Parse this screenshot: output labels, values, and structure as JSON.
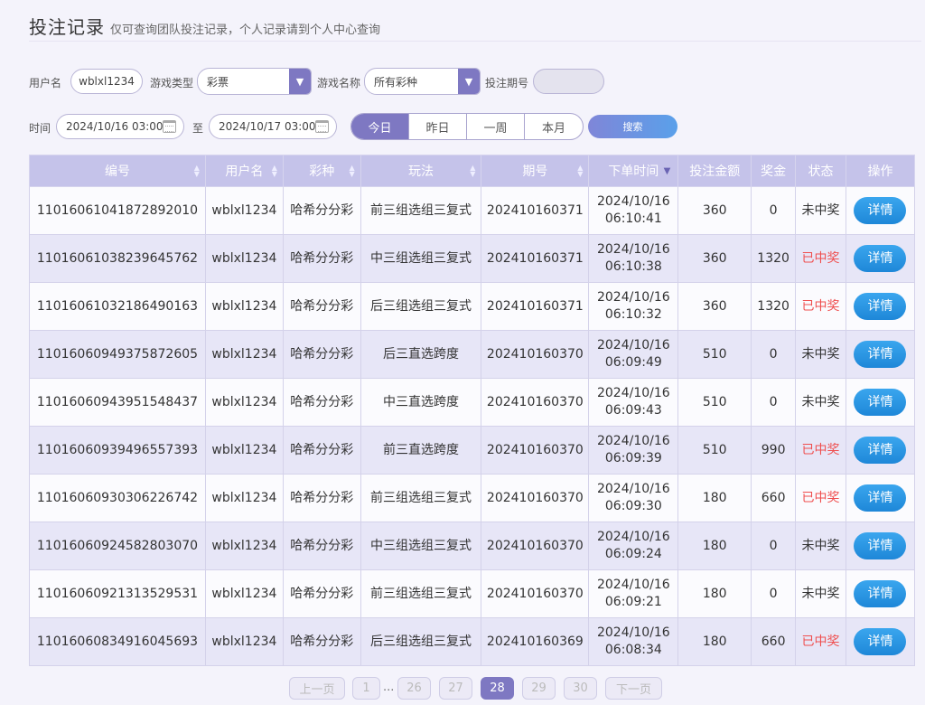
{
  "header": {
    "title": "投注记录",
    "subtitle": "仅可查询团队投注记录，个人记录请到个人中心查询"
  },
  "filters": {
    "username_label": "用户名",
    "username_value": "wblxl1234",
    "game_type_label": "游戏类型",
    "game_type_value": "彩票",
    "game_name_label": "游戏名称",
    "game_name_value": "所有彩种",
    "issue_label": "投注期号",
    "issue_value": "",
    "time_label": "时间",
    "start_time": "2024/10/16 03:00",
    "to_label": "至",
    "end_time": "2024/10/17 03:00",
    "ranges": [
      "今日",
      "昨日",
      "一周",
      "本月"
    ],
    "active_range": "今日",
    "search_label": "搜索"
  },
  "table": {
    "columns": [
      "编号",
      "用户名",
      "彩种",
      "玩法",
      "期号",
      "下单时间",
      "投注金额",
      "奖金",
      "状态",
      "操作"
    ],
    "rows": [
      {
        "id": "11016061041872892010",
        "user": "wblxl1234",
        "lottery": "哈希分分彩",
        "play": "前三组选组三复式",
        "issue": "202410160371",
        "date": "2024/10/16",
        "time": "06:10:41",
        "amount": "360",
        "prize": "0",
        "status": "未中奖",
        "action": "详情"
      },
      {
        "id": "11016061038239645762",
        "user": "wblxl1234",
        "lottery": "哈希分分彩",
        "play": "中三组选组三复式",
        "issue": "202410160371",
        "date": "2024/10/16",
        "time": "06:10:38",
        "amount": "360",
        "prize": "1320",
        "status": "已中奖",
        "action": "详情"
      },
      {
        "id": "11016061032186490163",
        "user": "wblxl1234",
        "lottery": "哈希分分彩",
        "play": "后三组选组三复式",
        "issue": "202410160371",
        "date": "2024/10/16",
        "time": "06:10:32",
        "amount": "360",
        "prize": "1320",
        "status": "已中奖",
        "action": "详情"
      },
      {
        "id": "11016060949375872605",
        "user": "wblxl1234",
        "lottery": "哈希分分彩",
        "play": "后三直选跨度",
        "issue": "202410160370",
        "date": "2024/10/16",
        "time": "06:09:49",
        "amount": "510",
        "prize": "0",
        "status": "未中奖",
        "action": "详情"
      },
      {
        "id": "11016060943951548437",
        "user": "wblxl1234",
        "lottery": "哈希分分彩",
        "play": "中三直选跨度",
        "issue": "202410160370",
        "date": "2024/10/16",
        "time": "06:09:43",
        "amount": "510",
        "prize": "0",
        "status": "未中奖",
        "action": "详情"
      },
      {
        "id": "11016060939496557393",
        "user": "wblxl1234",
        "lottery": "哈希分分彩",
        "play": "前三直选跨度",
        "issue": "202410160370",
        "date": "2024/10/16",
        "time": "06:09:39",
        "amount": "510",
        "prize": "990",
        "status": "已中奖",
        "action": "详情"
      },
      {
        "id": "11016060930306226742",
        "user": "wblxl1234",
        "lottery": "哈希分分彩",
        "play": "前三组选组三复式",
        "issue": "202410160370",
        "date": "2024/10/16",
        "time": "06:09:30",
        "amount": "180",
        "prize": "660",
        "status": "已中奖",
        "action": "详情"
      },
      {
        "id": "11016060924582803070",
        "user": "wblxl1234",
        "lottery": "哈希分分彩",
        "play": "中三组选组三复式",
        "issue": "202410160370",
        "date": "2024/10/16",
        "time": "06:09:24",
        "amount": "180",
        "prize": "0",
        "status": "未中奖",
        "action": "详情"
      },
      {
        "id": "11016060921313529531",
        "user": "wblxl1234",
        "lottery": "哈希分分彩",
        "play": "前三组选组三复式",
        "issue": "202410160370",
        "date": "2024/10/16",
        "time": "06:09:21",
        "amount": "180",
        "prize": "0",
        "status": "未中奖",
        "action": "详情"
      },
      {
        "id": "11016060834916045693",
        "user": "wblxl1234",
        "lottery": "哈希分分彩",
        "play": "后三组选组三复式",
        "issue": "202410160369",
        "date": "2024/10/16",
        "time": "06:08:34",
        "amount": "180",
        "prize": "660",
        "status": "已中奖",
        "action": "详情"
      }
    ]
  },
  "pagination": {
    "prev": "上一页",
    "first": "1",
    "ellipsis": "...",
    "pages": [
      "26",
      "27",
      "28",
      "29",
      "30"
    ],
    "current": "28",
    "next": "下一页"
  },
  "colors": {
    "accent": "#7e78c2",
    "header_bg": "#c5c3ea",
    "won": "#ef4f4f",
    "detail_button": "#1e87d8"
  }
}
